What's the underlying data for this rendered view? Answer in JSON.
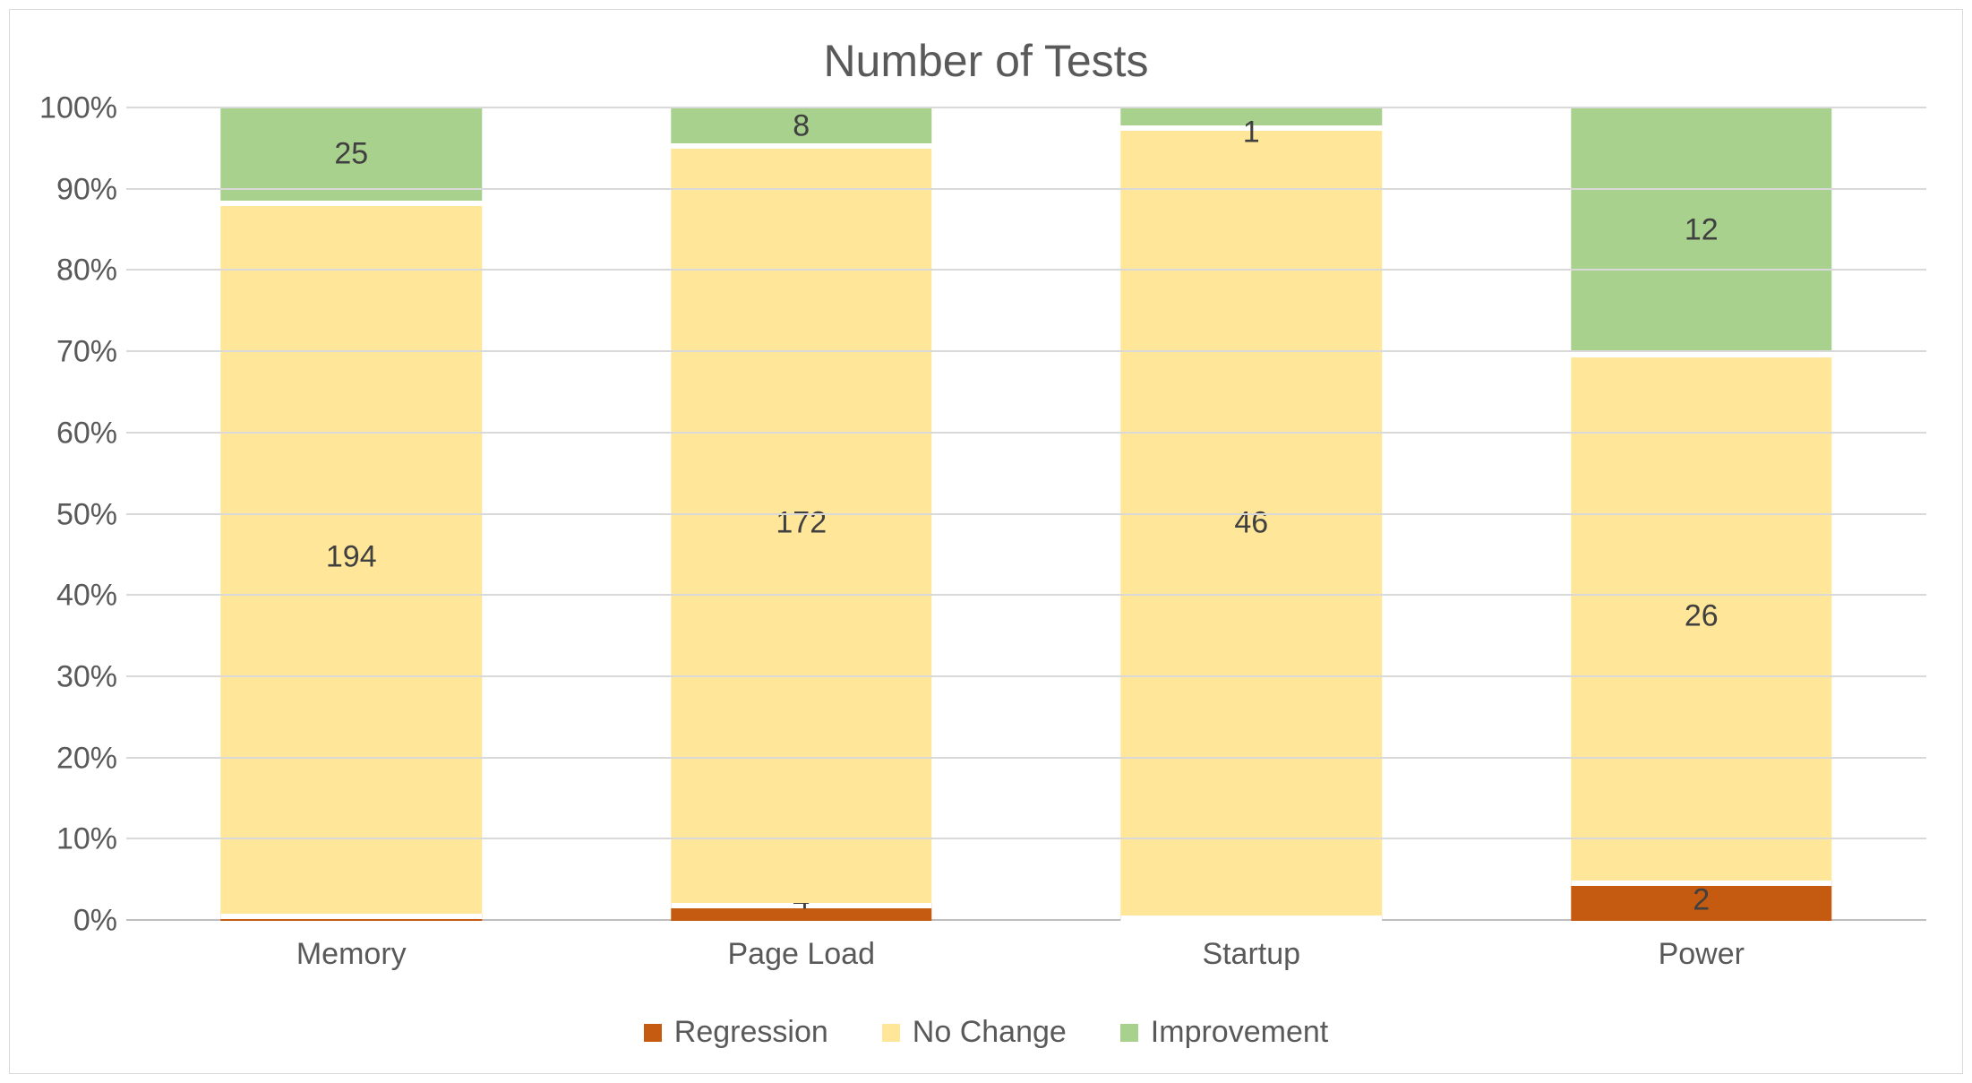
{
  "chart_data": {
    "type": "bar",
    "stacked": true,
    "normalized_to_100pct": true,
    "title": "Number of Tests",
    "xlabel": "",
    "ylabel": "",
    "ylim": [
      0,
      100
    ],
    "ytick_step": 10,
    "ytick_format_suffix": "%",
    "categories": [
      "Memory",
      "Page Load",
      "Startup",
      "Power"
    ],
    "series": [
      {
        "name": "Regression",
        "values": [
          2,
          4,
          0,
          2
        ],
        "color": "#c55a11"
      },
      {
        "name": "No Change",
        "values": [
          194,
          172,
          46,
          26
        ],
        "color": "#ffe699"
      },
      {
        "name": "Improvement",
        "values": [
          25,
          8,
          1,
          12
        ],
        "color": "#a9d18e"
      }
    ],
    "legend_position": "bottom",
    "grid": true
  }
}
